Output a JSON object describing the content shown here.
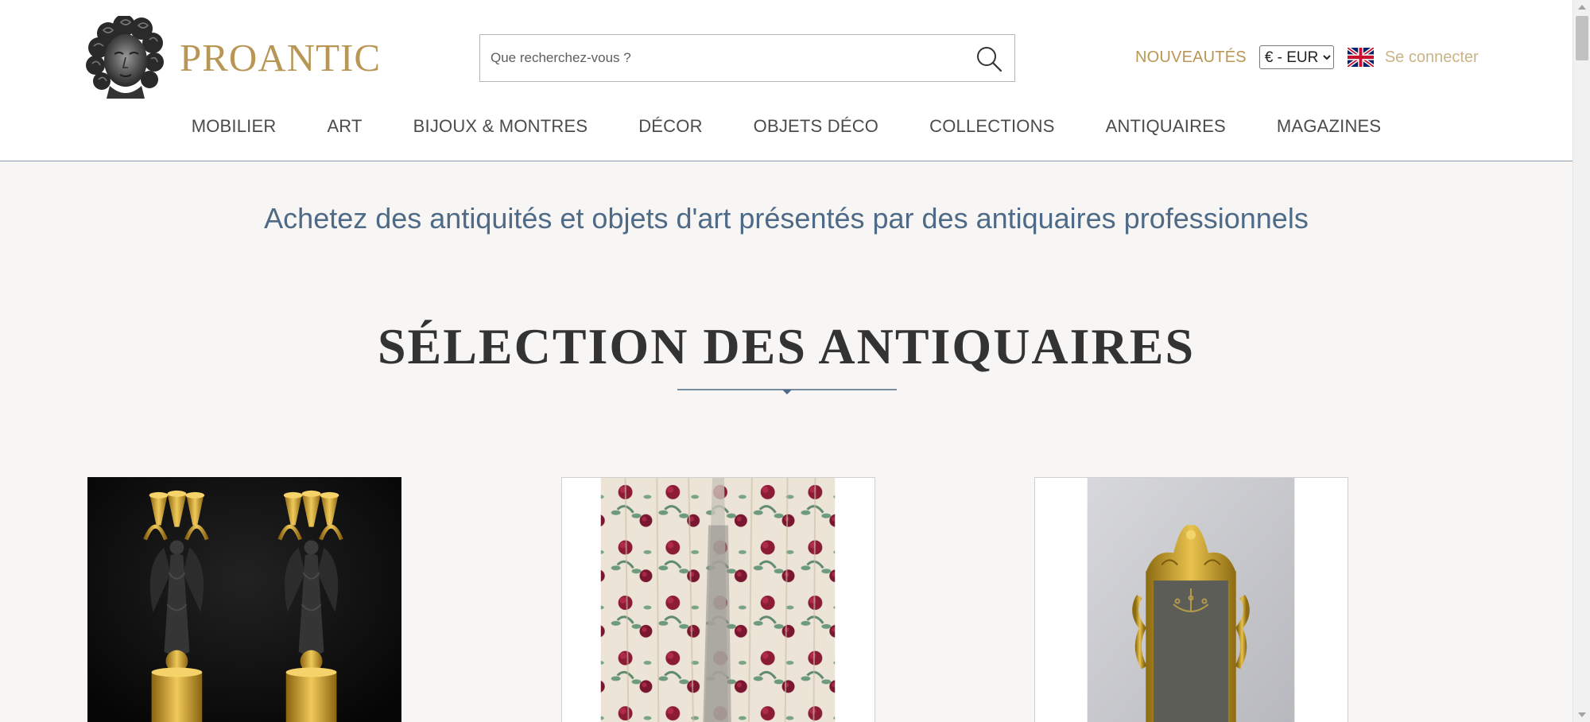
{
  "header": {
    "logo_text": "PROANTIC",
    "search": {
      "placeholder": "Que recherchez-vous ?",
      "value": ""
    },
    "new_label": "NOUVEAUTÉS",
    "currency": {
      "selected": "€ - EUR"
    },
    "login_label": "Se connecter"
  },
  "nav": {
    "items": [
      {
        "label": "MOBILIER"
      },
      {
        "label": "ART"
      },
      {
        "label": "BIJOUX & MONTRES"
      },
      {
        "label": "DÉCOR"
      },
      {
        "label": "OBJETS DÉCO"
      },
      {
        "label": "COLLECTIONS"
      },
      {
        "label": "ANTIQUAIRES"
      },
      {
        "label": "MAGAZINES"
      }
    ]
  },
  "main": {
    "tagline": "Achetez des antiquités et objets d'art présentés par des antiquaires professionnels",
    "section_title": "SÉLECTION DES ANTIQUAIRES",
    "cards": [
      {
        "image": "pair-of-empire-candelabra"
      },
      {
        "image": "floral-curtains"
      },
      {
        "image": "gilt-mirror"
      }
    ]
  },
  "colors": {
    "brand_gold": "#b89655",
    "accent_blue": "#4e6a87",
    "page_background": "#f7f6f4"
  },
  "icons": [
    "search-icon",
    "uk-flag-icon",
    "logo-bust-icon",
    "divider-diamond-icon"
  ]
}
